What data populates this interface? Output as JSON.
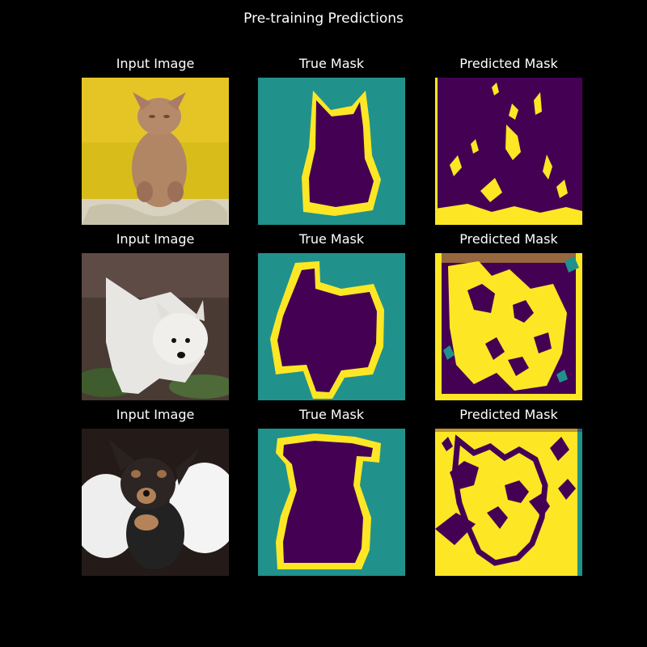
{
  "figure": {
    "title": "Pre-training Predictions"
  },
  "rows": [
    {
      "input_title": "Input Image",
      "true_title": "True Mask",
      "pred_title": "Predicted Mask",
      "subject": "hairless cat"
    },
    {
      "input_title": "Input Image",
      "true_title": "True Mask",
      "pred_title": "Predicted Mask",
      "subject": "white terrier"
    },
    {
      "input_title": "Input Image",
      "true_title": "True Mask",
      "pred_title": "Predicted Mask",
      "subject": "black and tan puppy"
    }
  ],
  "colors": {
    "background": "#000000",
    "mask_dark_purple": "#440154",
    "mask_teal": "#21918c",
    "mask_yellow": "#fde725"
  }
}
